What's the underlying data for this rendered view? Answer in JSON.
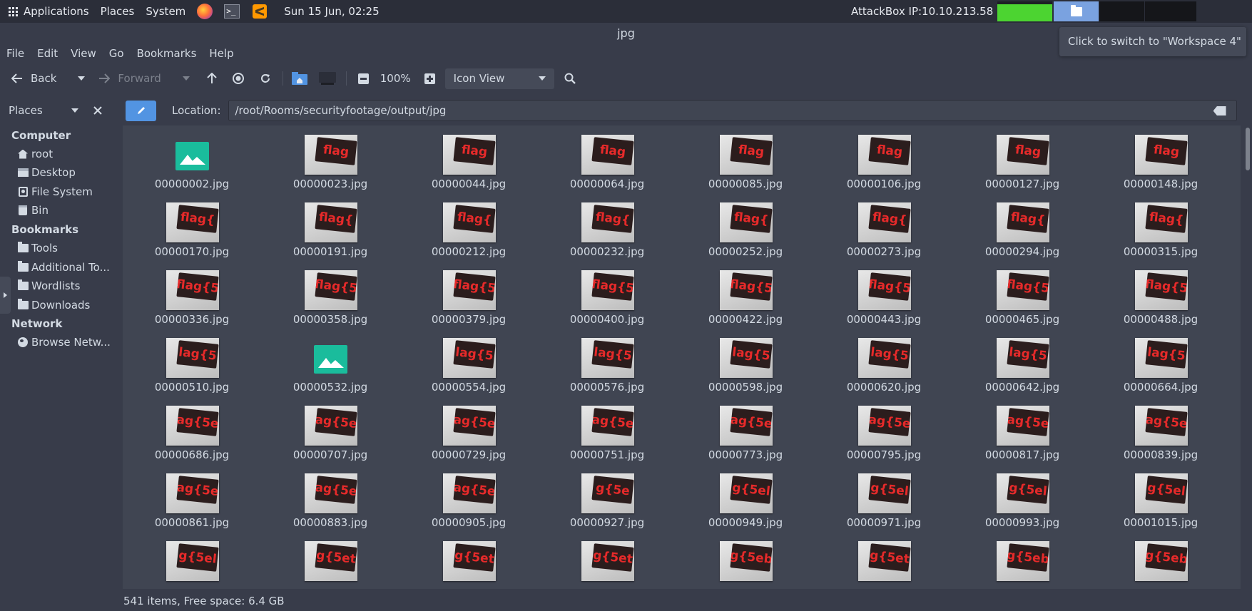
{
  "panel": {
    "applications": "Applications",
    "places": "Places",
    "system": "System",
    "clock": "Sun 15 Jun, 02:25",
    "attackbox": "AttackBox IP:10.10.213.58",
    "cpu_load": 0.85
  },
  "tooltip": "Click to switch to \"Workspace 4\"",
  "window": {
    "title": "jpg"
  },
  "menu": [
    "File",
    "Edit",
    "View",
    "Go",
    "Bookmarks",
    "Help"
  ],
  "toolbar": {
    "back": "Back",
    "forward": "Forward",
    "zoom": "100%",
    "view_mode": "Icon View"
  },
  "places_header": "Places",
  "location": {
    "label": "Location:",
    "path": "/root/Rooms/securityfootage/output/jpg"
  },
  "sidebar": {
    "computer_heading": "Computer",
    "computer": [
      {
        "label": "root",
        "icon": "home-icon"
      },
      {
        "label": "Desktop",
        "icon": "desktop-icon"
      },
      {
        "label": "File System",
        "icon": "drive-icon"
      },
      {
        "label": "Bin",
        "icon": "trash-icon"
      }
    ],
    "bookmarks_heading": "Bookmarks",
    "bookmarks": [
      {
        "label": "Tools",
        "icon": "folder-icon"
      },
      {
        "label": "Additional To...",
        "icon": "folder-icon"
      },
      {
        "label": "Wordlists",
        "icon": "folder-icon"
      },
      {
        "label": "Downloads",
        "icon": "folder-icon"
      }
    ],
    "network_heading": "Network",
    "network": [
      {
        "label": "Browse Netw...",
        "icon": "globe-icon"
      }
    ]
  },
  "files": [
    {
      "name": "00000002.jpg",
      "thumb": ""
    },
    {
      "name": "00000023.jpg",
      "thumb": "flag"
    },
    {
      "name": "00000044.jpg",
      "thumb": "flag"
    },
    {
      "name": "00000064.jpg",
      "thumb": "flag"
    },
    {
      "name": "00000085.jpg",
      "thumb": "flag"
    },
    {
      "name": "00000106.jpg",
      "thumb": "flag"
    },
    {
      "name": "00000127.jpg",
      "thumb": "flag"
    },
    {
      "name": "00000148.jpg",
      "thumb": "flag"
    },
    {
      "name": "00000170.jpg",
      "thumb": "flag{"
    },
    {
      "name": "00000191.jpg",
      "thumb": "flag{"
    },
    {
      "name": "00000212.jpg",
      "thumb": "flag{"
    },
    {
      "name": "00000232.jpg",
      "thumb": "flag{"
    },
    {
      "name": "00000252.jpg",
      "thumb": "flag{"
    },
    {
      "name": "00000273.jpg",
      "thumb": "flag{"
    },
    {
      "name": "00000294.jpg",
      "thumb": "flag{"
    },
    {
      "name": "00000315.jpg",
      "thumb": "flag{"
    },
    {
      "name": "00000336.jpg",
      "thumb": "flag{5"
    },
    {
      "name": "00000358.jpg",
      "thumb": "flag{5"
    },
    {
      "name": "00000379.jpg",
      "thumb": "flag{5"
    },
    {
      "name": "00000400.jpg",
      "thumb": "flag{5"
    },
    {
      "name": "00000422.jpg",
      "thumb": "flag{5"
    },
    {
      "name": "00000443.jpg",
      "thumb": "flag{5"
    },
    {
      "name": "00000465.jpg",
      "thumb": "flag{5"
    },
    {
      "name": "00000488.jpg",
      "thumb": "flag{5"
    },
    {
      "name": "00000510.jpg",
      "thumb": "lag{5"
    },
    {
      "name": "00000532.jpg",
      "thumb": ""
    },
    {
      "name": "00000554.jpg",
      "thumb": "lag{5"
    },
    {
      "name": "00000576.jpg",
      "thumb": "lag{5"
    },
    {
      "name": "00000598.jpg",
      "thumb": "lag{5"
    },
    {
      "name": "00000620.jpg",
      "thumb": "lag{5"
    },
    {
      "name": "00000642.jpg",
      "thumb": "lag{5"
    },
    {
      "name": "00000664.jpg",
      "thumb": "lag{5"
    },
    {
      "name": "00000686.jpg",
      "thumb": "ag{5e"
    },
    {
      "name": "00000707.jpg",
      "thumb": "ag{5e"
    },
    {
      "name": "00000729.jpg",
      "thumb": "ag{5e"
    },
    {
      "name": "00000751.jpg",
      "thumb": "ag{5e"
    },
    {
      "name": "00000773.jpg",
      "thumb": "ag{5e"
    },
    {
      "name": "00000795.jpg",
      "thumb": "ag{5e"
    },
    {
      "name": "00000817.jpg",
      "thumb": "ag{5e"
    },
    {
      "name": "00000839.jpg",
      "thumb": "ag{5e"
    },
    {
      "name": "00000861.jpg",
      "thumb": "ag{5e"
    },
    {
      "name": "00000883.jpg",
      "thumb": "ag{5e"
    },
    {
      "name": "00000905.jpg",
      "thumb": "ag{5e"
    },
    {
      "name": "00000927.jpg",
      "thumb": "g{5e"
    },
    {
      "name": "00000949.jpg",
      "thumb": "g{5el"
    },
    {
      "name": "00000971.jpg",
      "thumb": "g{5el"
    },
    {
      "name": "00000993.jpg",
      "thumb": "g{5el"
    },
    {
      "name": "00001015.jpg",
      "thumb": "g{5el"
    },
    {
      "name": "",
      "thumb": "g{5el"
    },
    {
      "name": "",
      "thumb": "g{5et"
    },
    {
      "name": "",
      "thumb": "g{5et"
    },
    {
      "name": "",
      "thumb": "g{5et"
    },
    {
      "name": "",
      "thumb": "g{5eb"
    },
    {
      "name": "",
      "thumb": "g{5et"
    },
    {
      "name": "",
      "thumb": "g{5eb"
    },
    {
      "name": "",
      "thumb": "g{5eb"
    }
  ],
  "status": "541 items, Free space: 6.4 GB"
}
